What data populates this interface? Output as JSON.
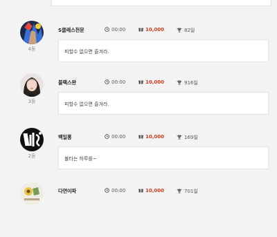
{
  "entries": [
    {
      "rank": "4등",
      "name": "S클레스천문",
      "time": "00:00",
      "price": "10,000",
      "trophy": "82일",
      "message": "피할수 없으면 즐겨라.",
      "avatar_icon": "anime-character-avatar"
    },
    {
      "rank": "3등",
      "name": "블랙스완",
      "time": "00:00",
      "price": "10,000",
      "trophy": "916일",
      "message": "피할수 없으면 즐겨라.",
      "avatar_icon": "portrait-photo-avatar"
    },
    {
      "rank": "2등",
      "name": "백일홍",
      "time": "00:00",
      "price": "10,000",
      "trophy": "169일",
      "message": "불타는 하루를~",
      "avatar_icon": "calligraphy-avatar"
    },
    {
      "rank": "",
      "name": "다연이파",
      "time": "00:00",
      "price": "10,000",
      "trophy": "701일",
      "message": "",
      "avatar_icon": "drawing-avatar"
    }
  ],
  "colors": {
    "price": "#d23c1a",
    "background": "#f3f3f3"
  }
}
